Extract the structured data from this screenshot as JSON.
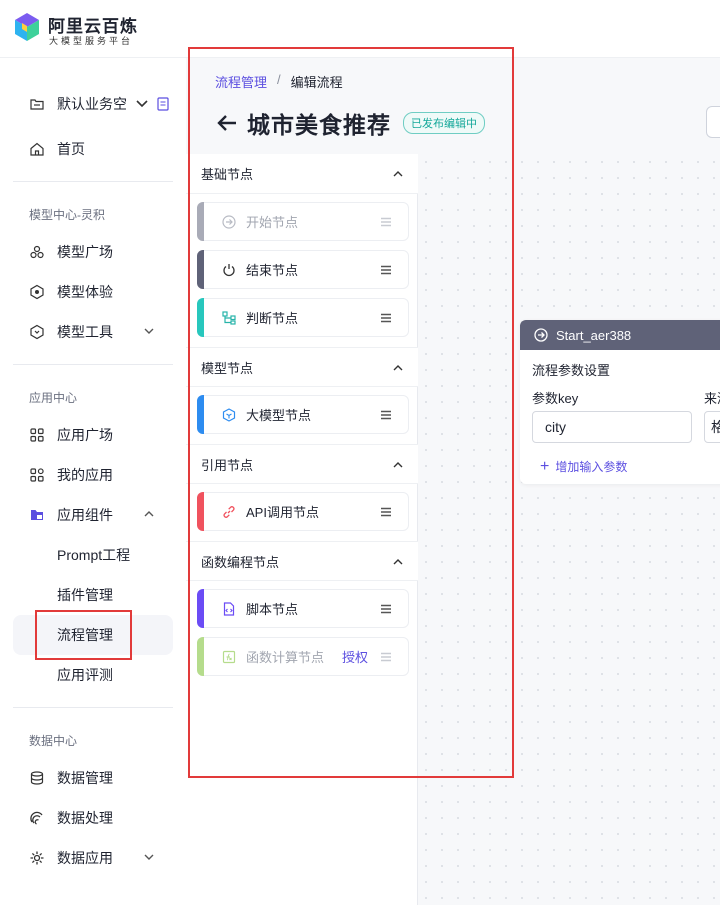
{
  "brand": {
    "title": "阿里云百炼",
    "subtitle": "大模型服务平台"
  },
  "workspace": {
    "name": "默认业务空间"
  },
  "sidebar": {
    "home": "首页",
    "section_model": "模型中心-灵积",
    "model_items": [
      "模型广场",
      "模型体验",
      "模型工具"
    ],
    "section_app": "应用中心",
    "app_items": [
      "应用广场",
      "我的应用",
      "应用组件"
    ],
    "app_sub_items": [
      "Prompt工程",
      "插件管理",
      "流程管理",
      "应用评测"
    ],
    "section_data": "数据中心",
    "data_items": [
      "数据管理",
      "数据处理",
      "数据应用"
    ]
  },
  "breadcrumb": {
    "parent": "流程管理",
    "separator": "/",
    "current": "编辑流程"
  },
  "page": {
    "title": "城市美食推荐",
    "status": "已发布编辑中"
  },
  "node_groups": [
    {
      "name": "基础节点",
      "nodes": [
        {
          "label": "开始节点",
          "color": "#a9abb7",
          "disabled": true
        },
        {
          "label": "结束节点",
          "color": "#5f6278",
          "disabled": false
        },
        {
          "label": "判断节点",
          "color": "#27c7bd",
          "disabled": false
        }
      ]
    },
    {
      "name": "模型节点",
      "nodes": [
        {
          "label": "大模型节点",
          "color": "#2d8cf0",
          "disabled": false
        }
      ]
    },
    {
      "name": "引用节点",
      "nodes": [
        {
          "label": "API调用节点",
          "color": "#f0525e",
          "disabled": false
        }
      ]
    },
    {
      "name": "函数编程节点",
      "nodes": [
        {
          "label": "脚本节点",
          "color": "#6b4cf5",
          "disabled": false
        },
        {
          "label": "函数计算节点",
          "color": "#b5dc8c",
          "disabled": true,
          "extra": "授权"
        }
      ]
    }
  ],
  "start_node": {
    "title": "Start_aer388",
    "section": "流程参数设置",
    "key_label": "参数key",
    "source_label": "来源",
    "key_value": "city",
    "source_value": "格",
    "add_param": "增加输入参数"
  },
  "colors": {
    "accent": "#5b4ee0",
    "status": "#14a89a",
    "highlight": "#e23a3a"
  }
}
